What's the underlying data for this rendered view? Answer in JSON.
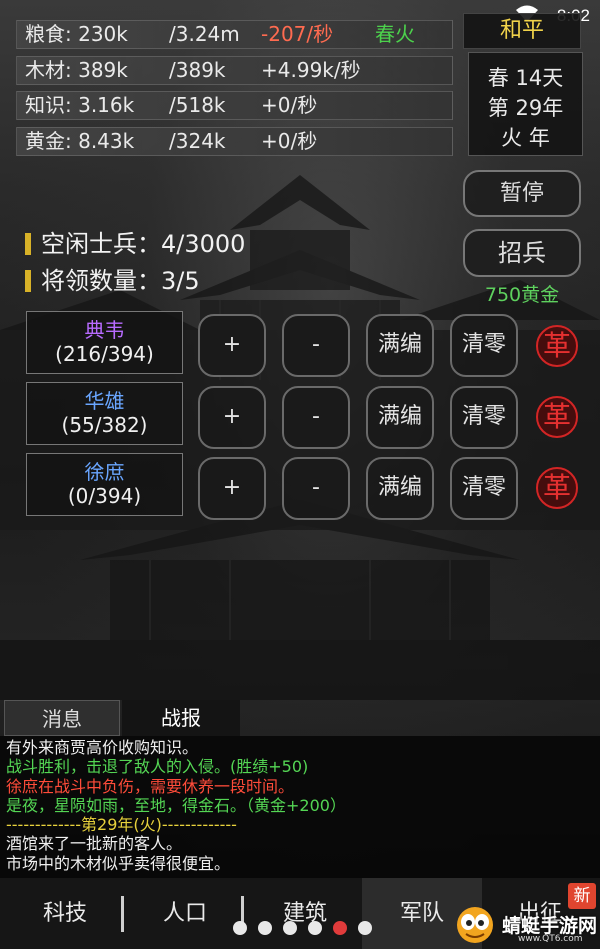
{
  "status_bar": {
    "time": "8:02"
  },
  "resources": [
    {
      "name": "粮食: 230k",
      "cap": "/3.24m",
      "rate": "-207/秒",
      "negative": true,
      "season": "春火"
    },
    {
      "name": "木材: 389k",
      "cap": "/389k",
      "rate": "+4.99k/秒",
      "negative": false,
      "season": ""
    },
    {
      "name": "知识: 3.16k",
      "cap": "/518k",
      "rate": "+0/秒",
      "negative": false,
      "season": ""
    },
    {
      "name": "黄金: 8.43k",
      "cap": "/324k",
      "rate": "+0/秒",
      "negative": false,
      "season": ""
    }
  ],
  "state": {
    "label": "和平"
  },
  "date": {
    "line1": "春 14天",
    "line2": "第 29年",
    "line3": "火 年"
  },
  "controls": {
    "pause": "暂停",
    "recruit": "招兵",
    "recruit_cost": "750黄金"
  },
  "stats": {
    "idle_soldiers": "空闲士兵：4/3000",
    "general_count": "将领数量：3/5"
  },
  "general_buttons": {
    "plus": "+",
    "minus": "-",
    "fill": "满编",
    "clear": "清零",
    "revolt": "革"
  },
  "generals": [
    {
      "name": "典韦",
      "count": "(216/394)",
      "color": "#b76bff"
    },
    {
      "name": "华雄",
      "count": "(55/382)",
      "color": "#6aa6ff"
    },
    {
      "name": "徐庶",
      "count": "(0/394)",
      "color": "#6aa6ff"
    }
  ],
  "tabs": {
    "messages": "消息",
    "battle": "战报"
  },
  "log": [
    {
      "text": "有外来商贾高价收购知识。",
      "color": "white"
    },
    {
      "text": "战斗胜利，击退了敌人的入侵。(胜绩+50)",
      "color": "green"
    },
    {
      "text": "徐庶在战斗中负伤，需要休养一段时间。",
      "color": "red"
    },
    {
      "text": "是夜，星陨如雨，至地，得金石。（黄金+200）",
      "color": "green"
    },
    {
      "text": "-------------第29年(火)-------------",
      "color": "yellow"
    },
    {
      "text": "酒馆来了一批新的客人。",
      "color": "white"
    },
    {
      "text": "市场中的木材似乎卖得很便宜。",
      "color": "white"
    }
  ],
  "nav": {
    "items": [
      "科技",
      "人口",
      "建筑",
      "军队",
      "出征"
    ],
    "active": 3,
    "badge": "新"
  },
  "pager": {
    "count": 6,
    "active": 4
  },
  "watermark": {
    "name": "蜻蜓手游网",
    "sub": "www.QT6.com"
  }
}
